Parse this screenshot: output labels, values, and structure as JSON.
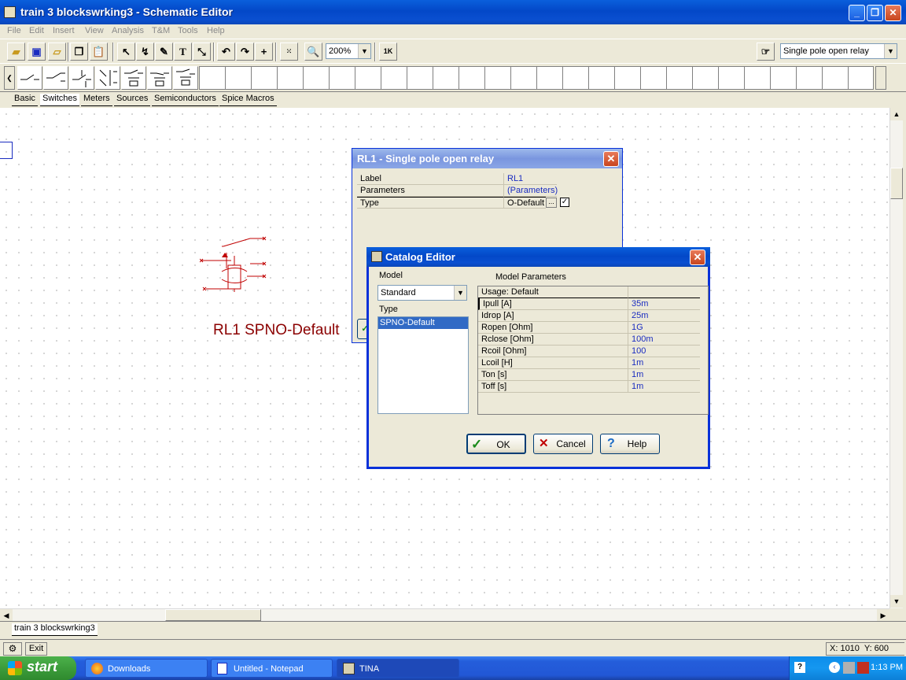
{
  "window": {
    "title": "train 3 blockswrking3 - Schematic Editor"
  },
  "menu": [
    "File",
    "Edit",
    "Insert",
    "View",
    "Analysis",
    "T&M",
    "Tools",
    "Help"
  ],
  "toolbar": {
    "zoom": "200%",
    "component_select": "Single pole open relay"
  },
  "tabs": [
    "Basic",
    "Switches",
    "Meters",
    "Sources",
    "Semiconductors",
    "Spice Macros"
  ],
  "schematic": {
    "component_label": "RL1 SPNO-Default"
  },
  "relay_dialog": {
    "title": "RL1 - Single pole open relay",
    "rows": [
      {
        "name": "Label",
        "value": "RL1"
      },
      {
        "name": "Parameters",
        "value": "(Parameters)"
      },
      {
        "name": "Type",
        "value": "O-Default"
      }
    ],
    "type_button": "..."
  },
  "catalog_editor": {
    "title": "Catalog Editor",
    "model_label": "Model",
    "model_value": "Standard",
    "type_label": "Type",
    "type_items": [
      "SPNO-Default"
    ],
    "params_label": "Model Parameters",
    "usage": "Usage: Default",
    "params": [
      {
        "name": "Ipull [A]",
        "value": "35m"
      },
      {
        "name": "Idrop [A]",
        "value": "25m"
      },
      {
        "name": "Ropen [Ohm]",
        "value": "1G"
      },
      {
        "name": "Rclose [Ohm]",
        "value": "100m"
      },
      {
        "name": "Rcoil [Ohm]",
        "value": "100"
      },
      {
        "name": "Lcoil [H]",
        "value": "1m"
      },
      {
        "name": "Ton [s]",
        "value": "1m"
      },
      {
        "name": "Toff [s]",
        "value": "1m"
      }
    ],
    "buttons": {
      "ok": "OK",
      "cancel": "Cancel",
      "help": "Help"
    }
  },
  "document_tab": "train 3 blockswrking3",
  "status": {
    "exit": "Exit",
    "coords": "X: 1010  Y: 600"
  },
  "taskbar": {
    "start": "start",
    "tasks": [
      "Downloads",
      "Untitled - Notepad",
      "TINA"
    ],
    "clock": "1:13 PM"
  }
}
